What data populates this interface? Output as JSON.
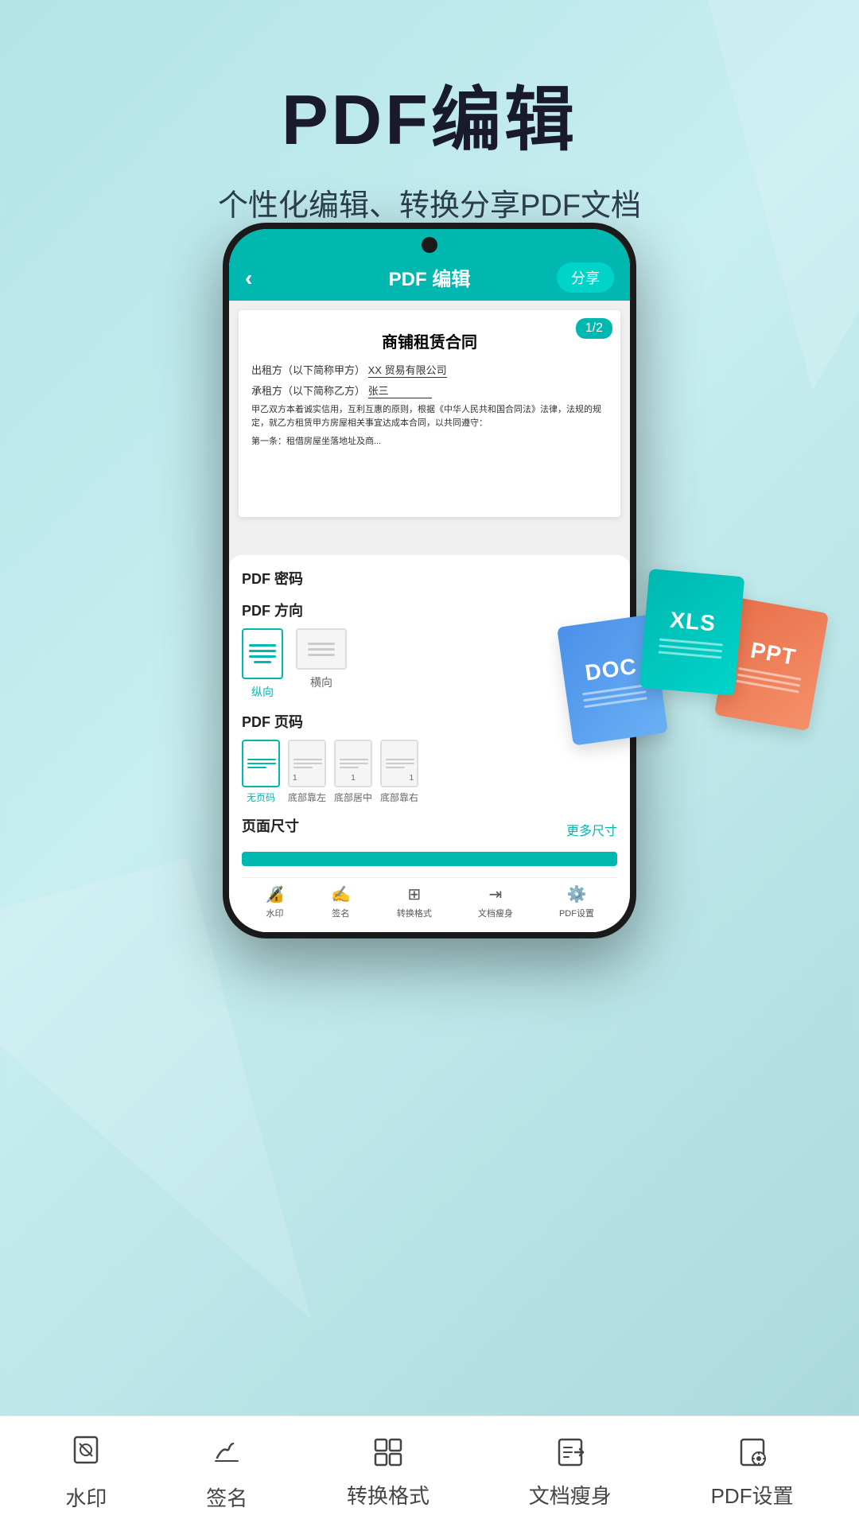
{
  "app": {
    "main_title": "PDF编辑",
    "subtitle": "个性化编辑、转换分享PDF文档"
  },
  "phone": {
    "header": {
      "title": "PDF 编辑",
      "back_icon": "‹",
      "share_label": "分享"
    },
    "document": {
      "title": "商铺租赁合同",
      "page_badge": "1/2",
      "line1": "出租方（以下简称甲方）XX 贸易有限公司",
      "line2": "承租方（以下简称乙方）张三",
      "line3": "甲乙双方本着诚实信用，互利互惠的原则，根据《中华人民共和国合同法》法律，法规的规定，就乙方租赁甲方房屋相关事宜达成本合同，以共同遵守：",
      "line4": "第一条：租借房屋坐落地址及商..."
    },
    "pdf_password": {
      "label": "PDF 密码"
    },
    "pdf_direction": {
      "label": "PDF 方向",
      "portrait_label": "纵向",
      "landscape_label": "横向"
    },
    "pdf_page_num": {
      "label": "PDF 页码",
      "no_page_label": "无页码",
      "bottom_left_label": "底部靠左",
      "bottom_center_label": "底部居中",
      "bottom_right_label": "底部靠右"
    },
    "page_size": {
      "label": "页面尺寸",
      "more_sizes_label": "更多尺寸"
    }
  },
  "bottom_toolbar": {
    "items": [
      {
        "icon": "stamp",
        "label": "水印"
      },
      {
        "icon": "sign",
        "label": "签名"
      },
      {
        "icon": "convert",
        "label": "转换格式"
      },
      {
        "icon": "slim",
        "label": "文档瘦身"
      },
      {
        "icon": "settings",
        "label": "PDF设置"
      }
    ]
  },
  "doc_cards": [
    {
      "label": "DOC",
      "color_start": "#4a90e8",
      "color_end": "#6ab0f5"
    },
    {
      "label": "XLS",
      "color_start": "#00b8b0",
      "color_end": "#00d4ca"
    },
    {
      "label": "PPT",
      "color_start": "#e8704a",
      "color_end": "#f5906a"
    }
  ]
}
